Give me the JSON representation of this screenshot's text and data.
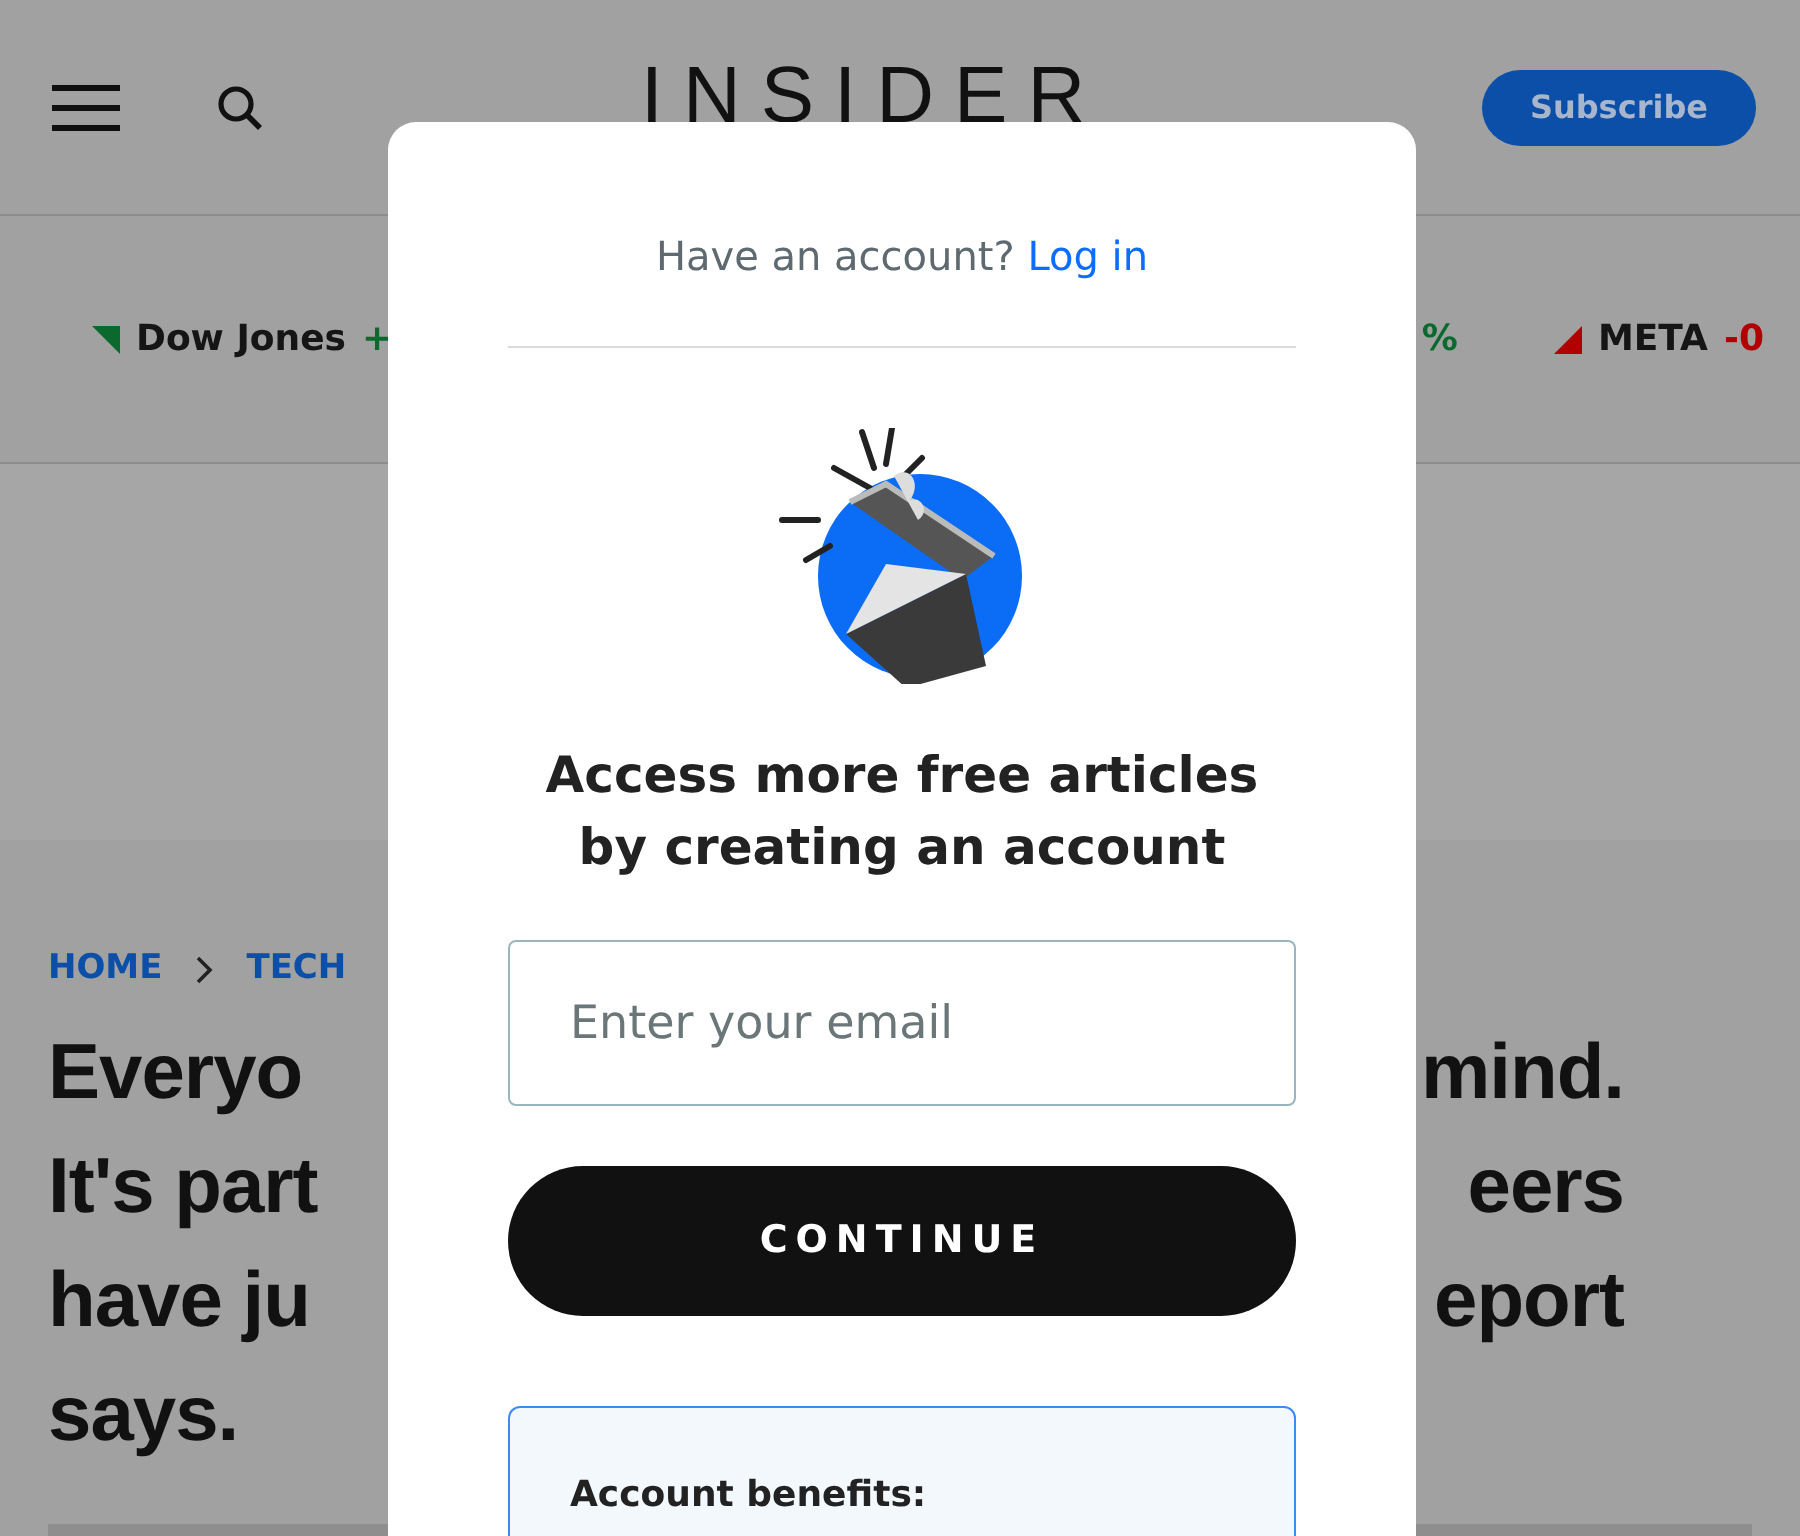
{
  "header": {
    "logo": "INSIDER",
    "subscribe": "Subscribe"
  },
  "ticker": [
    {
      "symbol": "Dow Jones",
      "change": "+",
      "kind": "up"
    },
    {
      "change": "%",
      "kind": "up"
    },
    {
      "symbol": "META",
      "change": "-0",
      "kind": "down"
    }
  ],
  "breadcrumbs": [
    "HOME",
    "TECH"
  ],
  "headline": {
    "left": [
      "Everyo",
      "It's part",
      "have ju",
      "says."
    ],
    "right": [
      "mind.",
      "eers",
      "eport"
    ]
  },
  "modal": {
    "prompt": "Have an account?",
    "login_link": "Log in",
    "heading": "Access more free articles by creating an account",
    "email_placeholder": "Enter your email",
    "button": "CONTINUE",
    "benefits_title": "Account benefits:"
  }
}
